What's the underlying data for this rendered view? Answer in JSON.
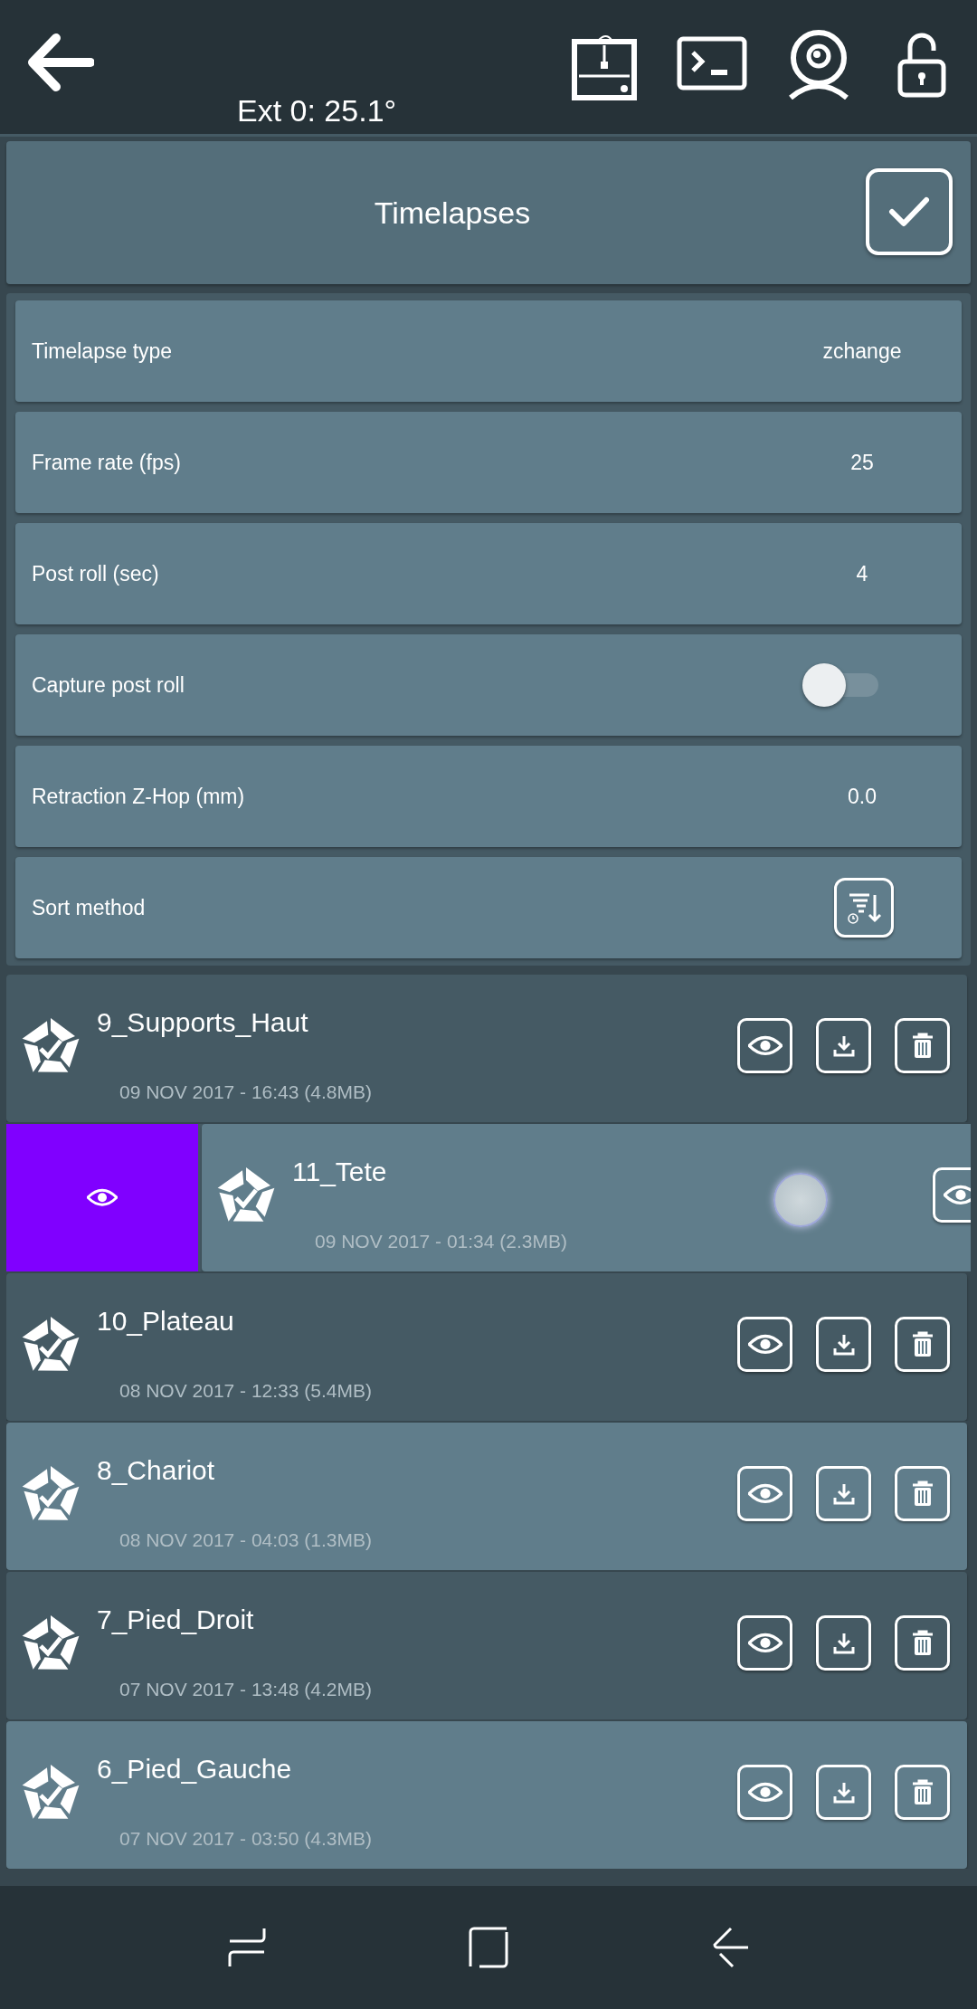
{
  "top_bar": {
    "status_text": "Ext 0: 25.1°"
  },
  "panel": {
    "title": "Timelapses"
  },
  "settings": [
    {
      "kind": "value",
      "label": "Timelapse type",
      "value": "zchange"
    },
    {
      "kind": "value",
      "label": "Frame rate (fps)",
      "value": "25"
    },
    {
      "kind": "value",
      "label": "Post roll (sec)",
      "value": "4"
    },
    {
      "kind": "toggle",
      "label": "Capture post roll",
      "on": false
    },
    {
      "kind": "value",
      "label": "Retraction Z-Hop (mm)",
      "value": "0.0"
    },
    {
      "kind": "sort",
      "label": "Sort method"
    }
  ],
  "timelapses": [
    {
      "name": "9_Supports_Haut",
      "info": "09 NOV 2017 - 16:43 (4.8MB)",
      "swiped": false
    },
    {
      "name": "11_Tete",
      "info": "09 NOV 2017 - 01:34 (2.3MB)",
      "swiped": true
    },
    {
      "name": "10_Plateau",
      "info": "08 NOV 2017 - 12:33 (5.4MB)",
      "swiped": false
    },
    {
      "name": "8_Chariot",
      "info": "08 NOV 2017 - 04:03 (1.3MB)",
      "swiped": false
    },
    {
      "name": "7_Pied_Droit",
      "info": "07 NOV 2017 - 13:48 (4.2MB)",
      "swiped": false
    },
    {
      "name": "6_Pied_Gauche",
      "info": "07 NOV 2017 - 03:50 (4.3MB)",
      "swiped": false
    }
  ]
}
